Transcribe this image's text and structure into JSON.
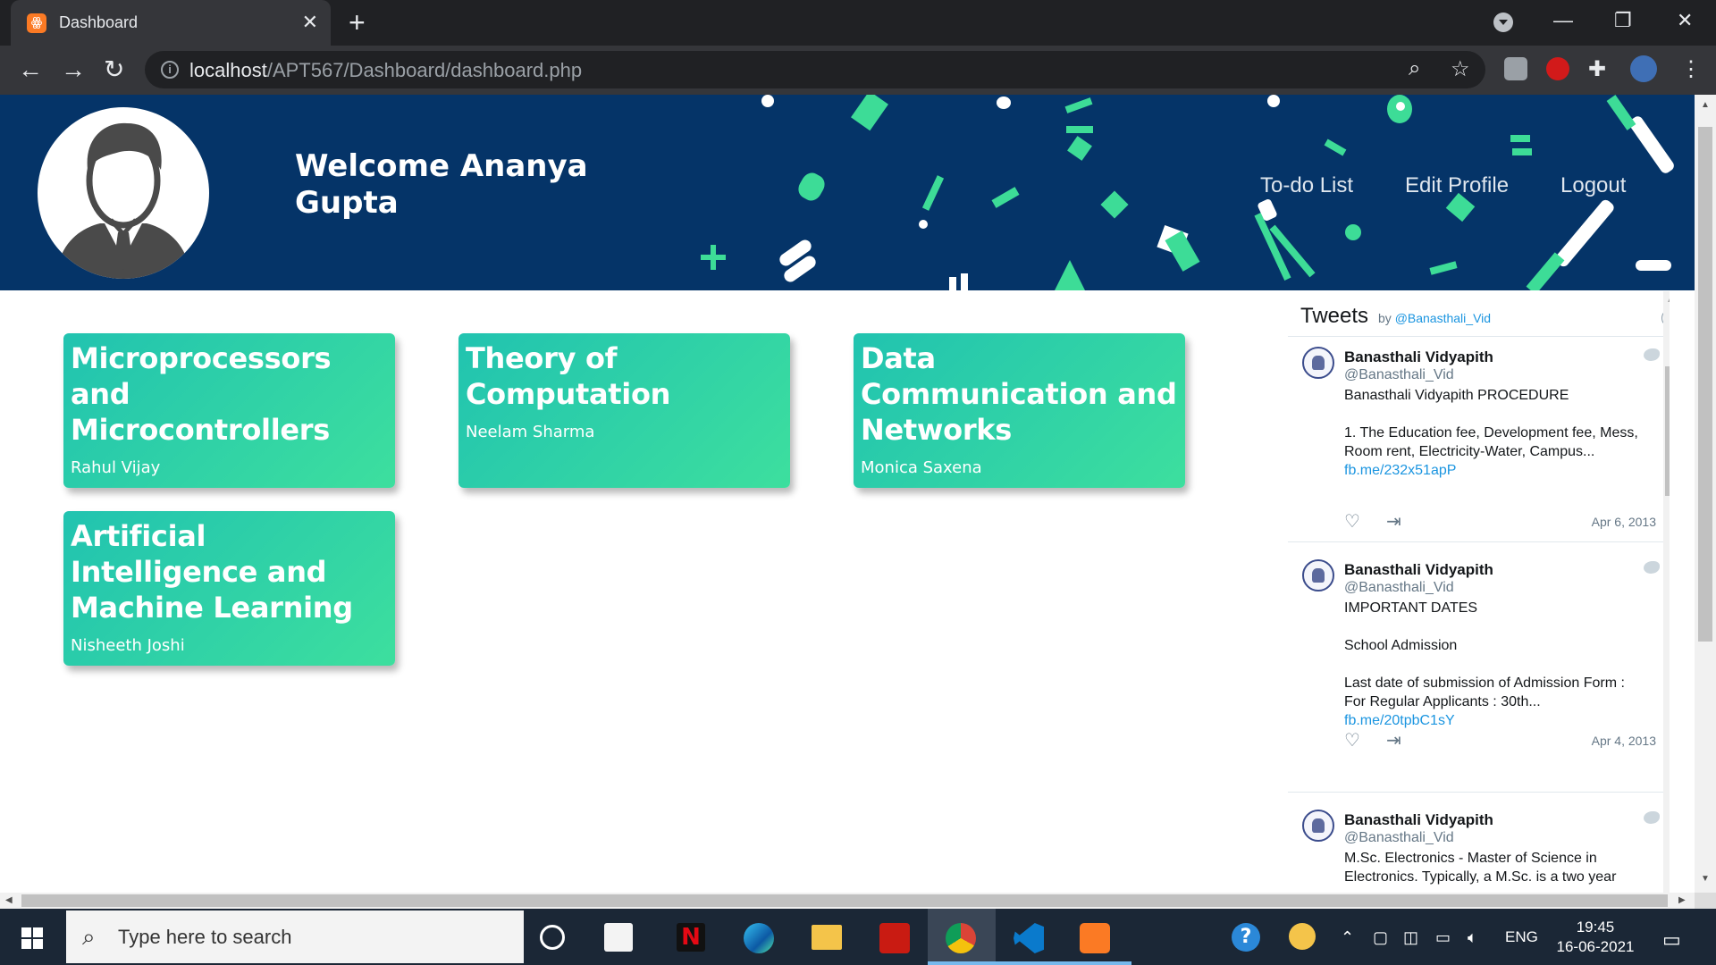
{
  "browser": {
    "tab_title": "Dashboard",
    "tab_close": "✕",
    "new_tab": "+",
    "url_host": "localhost",
    "url_path": "/APT567/Dashboard/dashboard.php",
    "window_controls": {
      "minimize": "—",
      "restore": "❐",
      "close": "✕"
    }
  },
  "header": {
    "welcome": "Welcome Ananya Gupta",
    "nav": [
      {
        "label": "To-do List"
      },
      {
        "label": "Edit Profile"
      },
      {
        "label": "Logout"
      }
    ]
  },
  "courses": [
    {
      "title": "Microprocessors and Microcontrollers",
      "teacher": "Rahul Vijay"
    },
    {
      "title": "Theory of Computation",
      "teacher": "Neelam Sharma"
    },
    {
      "title": "Data Communication and Networks",
      "teacher": "Monica Saxena"
    },
    {
      "title": "Artificial Intelligence and Machine Learning",
      "teacher": "Nisheeth Joshi"
    }
  ],
  "tweets_widget": {
    "title": "Tweets",
    "by_prefix": "by",
    "by_handle": "@Banasthali_Vid",
    "info_icon": "i",
    "tweets": [
      {
        "name": "Banasthali Vidyapith",
        "handle": "@Banasthali_Vid",
        "text": "Banasthali Vidyapith PROCEDURE\n\n1. The Education fee, Development fee, Mess, Room rent, Electricity-Water, Campus...",
        "link": "fb.me/232x51apP",
        "date": "Apr 6, 2013"
      },
      {
        "name": "Banasthali Vidyapith",
        "handle": "@Banasthali_Vid",
        "text": "IMPORTANT DATES\n\nSchool Admission\n\nLast date of submission of Admission Form :\n For Regular Applicants : 30th...",
        "link": "fb.me/20tpbC1sY",
        "date": "Apr 4, 2013"
      },
      {
        "name": "Banasthali Vidyapith",
        "handle": "@Banasthali_Vid",
        "text": "M.Sc. Electronics - Master of Science in Electronics. Typically, a M.Sc. is a two year",
        "link": "",
        "date": ""
      }
    ]
  },
  "taskbar": {
    "search_placeholder": "Type here to search",
    "language": "ENG",
    "time": "19:45",
    "date": "16-06-2021"
  },
  "colors": {
    "header_bg": "#053468",
    "accent_green": "#3ddc97",
    "card_gradient_start": "#21c3b0",
    "card_gradient_end": "#3ddf9e",
    "link_blue": "#1b95e0"
  }
}
